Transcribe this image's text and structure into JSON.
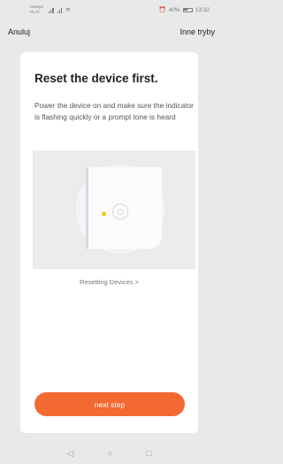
{
  "status_bar": {
    "carrier_line1": "Orange",
    "carrier_line2": "PLAY",
    "battery": "40%",
    "time": "13:32",
    "icons": [
      "signal-icon",
      "signal-icon",
      "wifi-icon",
      "alarm-icon",
      "battery-icon"
    ]
  },
  "nav": {
    "cancel_label": "Anuluj",
    "other_modes_label": "Inne tryby"
  },
  "card": {
    "title": "Reset the device first.",
    "description": "Power the device on and make sure the indicator is flashing quickly or a prompt tone is heard",
    "illustration_icons": [
      "device-icon",
      "indicator-light-icon",
      "power-icon"
    ],
    "reset_link": "Resetting Devices >",
    "next_button": "next step"
  },
  "colors": {
    "accent": "#f26a32",
    "indicator": "#f2c51b",
    "background": "#e9e9e9",
    "card": "#ffffff"
  },
  "system_nav": {
    "back": "◁",
    "home": "○",
    "recent": "□"
  }
}
